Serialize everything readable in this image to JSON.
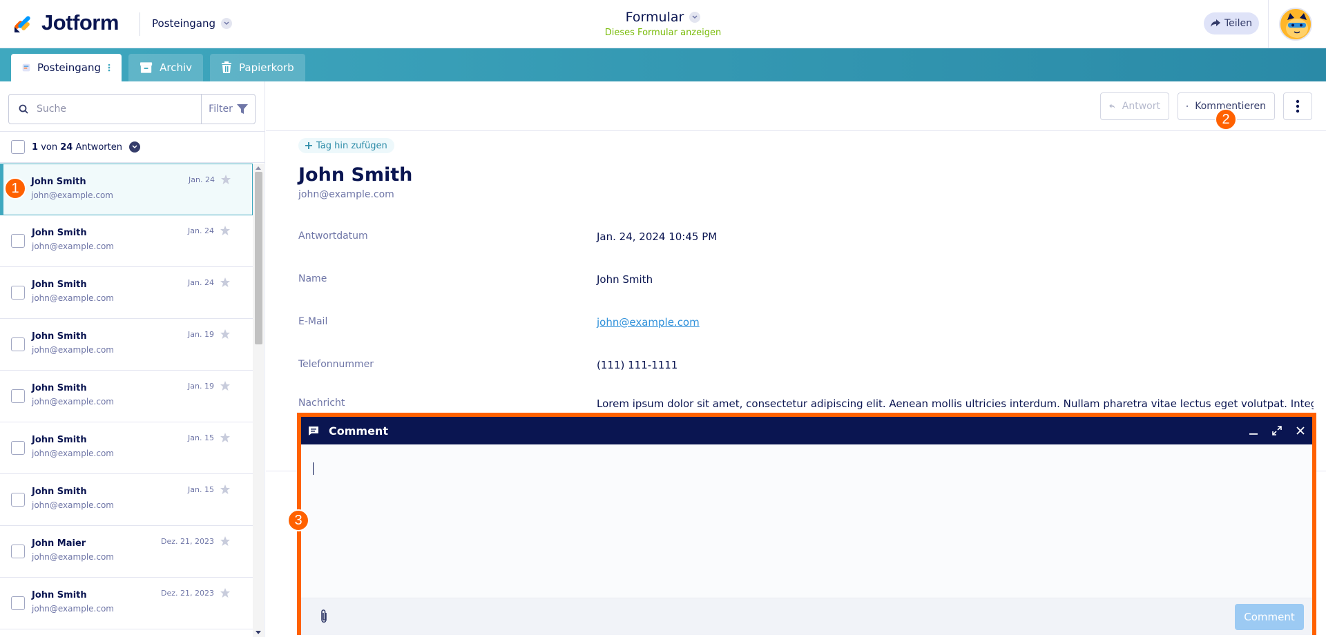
{
  "header": {
    "brand": "Jotform",
    "inbox_dropdown": "Posteingang",
    "form_title": "Formular",
    "form_subtitle": "Dieses Formular anzeigen",
    "share_label": "Teilen"
  },
  "tabs": [
    {
      "label": "Posteingang",
      "icon": "inbox-icon"
    },
    {
      "label": "Archiv",
      "icon": "archive-icon"
    },
    {
      "label": "Papierkorb",
      "icon": "trash-icon"
    }
  ],
  "sidebar": {
    "search_placeholder": "Suche",
    "filter_label": "Filter",
    "count": {
      "selected": "1",
      "of": "von",
      "total": "24",
      "label": "Antworten"
    },
    "items": [
      {
        "name": "John Smith",
        "email": "john@example.com",
        "date": "Jan. 24"
      },
      {
        "name": "John Smith",
        "email": "john@example.com",
        "date": "Jan. 24"
      },
      {
        "name": "John Smith",
        "email": "john@example.com",
        "date": "Jan. 24"
      },
      {
        "name": "John Smith",
        "email": "john@example.com",
        "date": "Jan. 19"
      },
      {
        "name": "John Smith",
        "email": "john@example.com",
        "date": "Jan. 19"
      },
      {
        "name": "John Smith",
        "email": "john@example.com",
        "date": "Jan. 15"
      },
      {
        "name": "John Smith",
        "email": "john@example.com",
        "date": "Jan. 15"
      },
      {
        "name": "John Maier",
        "email": "john@example.com",
        "date": "Dez. 21, 2023"
      },
      {
        "name": "John Smith",
        "email": "john@example.com",
        "date": "Dez. 21, 2023"
      }
    ]
  },
  "toolbar": {
    "reply_label": "Antwort",
    "comment_label": "Kommentieren"
  },
  "submission": {
    "tag_add": "Tag hin zufügen",
    "name": "John Smith",
    "email": "john@example.com",
    "fields": [
      {
        "label": "Antwortdatum",
        "value": "Jan. 24, 2024 10:45 PM"
      },
      {
        "label": "Name",
        "value": "John Smith"
      },
      {
        "label": "E-Mail",
        "value": "john@example.com"
      },
      {
        "label": "Telefonnummer",
        "value": "(111) 111-1111"
      },
      {
        "label": "Nachricht",
        "value": "Lorem ipsum dolor sit amet, consectetur adipiscing elit. Aenean mollis ultricies interdum. Nullam pharetra vitae lectus eget volutpat. Integer"
      }
    ]
  },
  "comment_modal": {
    "title": "Comment",
    "submit_label": "Comment"
  },
  "step_badges": [
    "1",
    "2",
    "3"
  ],
  "colors": {
    "navy": "#0a1551",
    "teal": "#3fa8bf",
    "highlight": "#ff6100",
    "link": "#2e90da",
    "green": "#78bb07"
  }
}
